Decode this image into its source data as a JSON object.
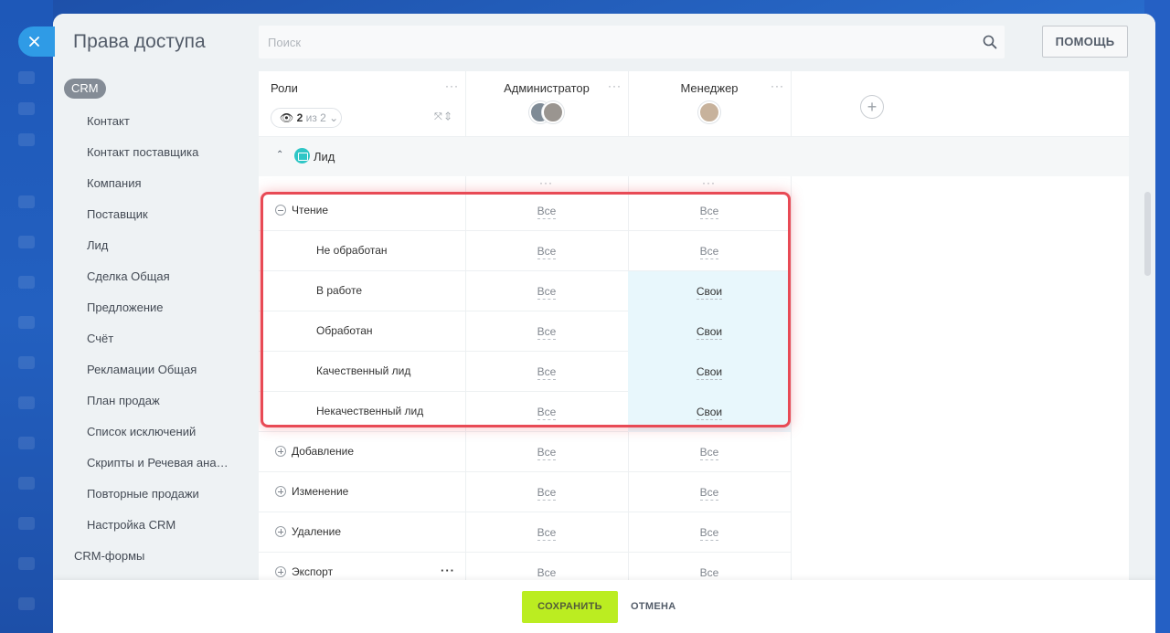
{
  "title": "Права доступа",
  "search": {
    "placeholder": "Поиск"
  },
  "help_label": "ПОМОЩЬ",
  "sidebar": {
    "badge": "CRM",
    "items": [
      "Контакт",
      "Контакт поставщика",
      "Компания",
      "Поставщик",
      "Лид",
      "Сделка Общая",
      "Предложение",
      "Счёт",
      "Рекламации Общая",
      "План продаж",
      "Список исключений",
      "Скрипты и Речевая ана…",
      "Повторные продажи",
      "Настройка CRM"
    ],
    "root_item": "CRM-формы"
  },
  "table": {
    "roles_header": "Роли",
    "roles_counter": {
      "shown": "2",
      "of": "из 2"
    },
    "columns": [
      {
        "title": "Администратор"
      },
      {
        "title": "Менеджер"
      }
    ],
    "section": "Лид",
    "rows": [
      {
        "label": "Чтение",
        "level": 0,
        "icon": "minus",
        "admin": "Все",
        "manager": "Все",
        "highlight": false
      },
      {
        "label": "Не обработан",
        "level": 1,
        "admin": "Все",
        "manager": "Все",
        "highlight": false
      },
      {
        "label": "В работе",
        "level": 1,
        "admin": "Все",
        "manager": "Свои",
        "highlight": true
      },
      {
        "label": "Обработан",
        "level": 1,
        "admin": "Все",
        "manager": "Свои",
        "highlight": true
      },
      {
        "label": "Качественный лид",
        "level": 1,
        "admin": "Все",
        "manager": "Свои",
        "highlight": true
      },
      {
        "label": "Некачественный лид",
        "level": 1,
        "admin": "Все",
        "manager": "Свои",
        "highlight": true
      },
      {
        "label": "Добавление",
        "level": 0,
        "icon": "plus",
        "admin": "Все",
        "manager": "Все",
        "highlight": false
      },
      {
        "label": "Изменение",
        "level": 0,
        "icon": "plus",
        "admin": "Все",
        "manager": "Все",
        "highlight": false
      },
      {
        "label": "Удаление",
        "level": 0,
        "icon": "plus",
        "admin": "Все",
        "manager": "Все",
        "highlight": false
      },
      {
        "label": "Экспорт",
        "level": 0,
        "icon": "plus",
        "admin": "Все",
        "manager": "Все",
        "highlight": false,
        "more": true
      }
    ]
  },
  "footer": {
    "save_label": "СОХРАНИТЬ",
    "cancel_label": "ОТМЕНА"
  },
  "colors": {
    "accent_save": "#bbed21",
    "highlight_border": "#e84a55",
    "cell_highlight": "#e8f7fc",
    "badge": "#848c96"
  }
}
